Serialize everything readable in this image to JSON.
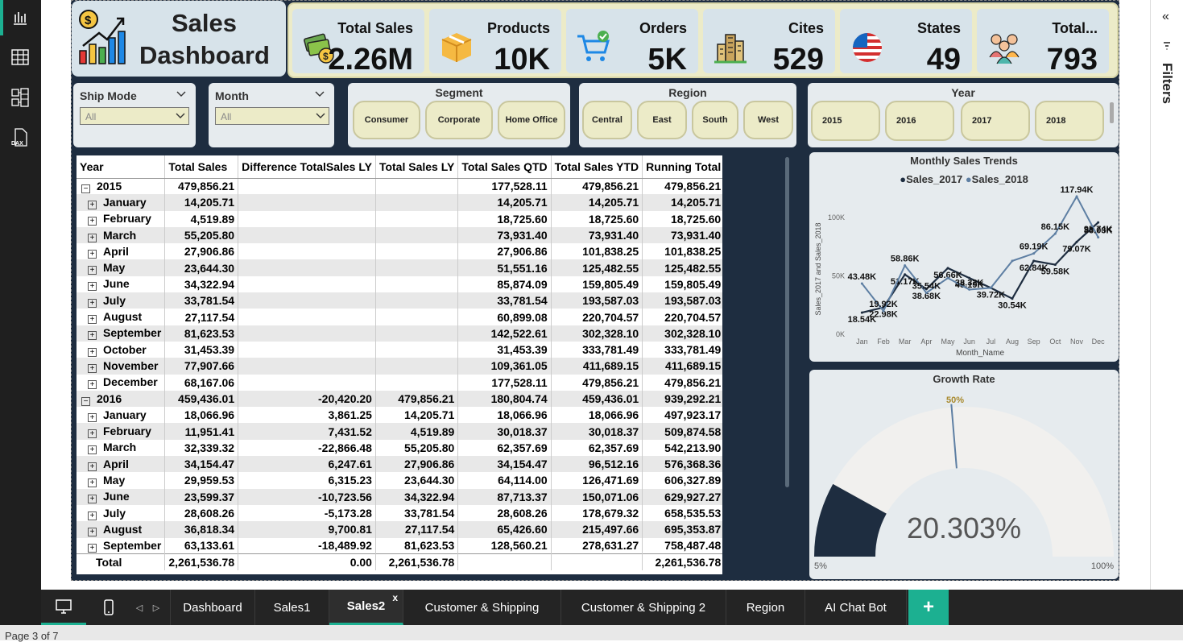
{
  "kpis": {
    "title_line1": "Sales",
    "title_line2": "Dashboard",
    "items": [
      {
        "label": "Total Sales",
        "value": "2.26M",
        "icon": "money-icon"
      },
      {
        "label": "Products",
        "value": "10K",
        "icon": "box-icon"
      },
      {
        "label": "Orders",
        "value": "5K",
        "icon": "cart-icon"
      },
      {
        "label": "Cites",
        "value": "529",
        "icon": "city-icon"
      },
      {
        "label": "States",
        "value": "49",
        "icon": "flag-icon"
      },
      {
        "label": "Total...",
        "value": "793",
        "icon": "people-icon"
      }
    ]
  },
  "filters": {
    "ship_mode": {
      "label": "Ship Mode",
      "value": "All"
    },
    "month": {
      "label": "Month",
      "value": "All"
    },
    "segment": {
      "label": "Segment",
      "options": [
        "Consumer",
        "Corporate",
        "Home Office"
      ]
    },
    "region": {
      "label": "Region",
      "options": [
        "Central",
        "East",
        "South",
        "West"
      ]
    },
    "year": {
      "label": "Year",
      "options": [
        "2015",
        "2016",
        "2017",
        "2018"
      ]
    }
  },
  "table": {
    "headers": [
      "Year",
      "Total Sales",
      "Difference TotalSales LY",
      "Total Sales LY",
      "Total Sales QTD",
      "Total Sales YTD",
      "Running Total"
    ],
    "rows": [
      {
        "label": "2015",
        "level": 0,
        "cells": [
          "479,856.21",
          "",
          "",
          "177,528.11",
          "479,856.21",
          "479,856.21"
        ]
      },
      {
        "label": "January",
        "level": 1,
        "cells": [
          "14,205.71",
          "",
          "",
          "14,205.71",
          "14,205.71",
          "14,205.71"
        ]
      },
      {
        "label": "February",
        "level": 1,
        "cells": [
          "4,519.89",
          "",
          "",
          "18,725.60",
          "18,725.60",
          "18,725.60"
        ]
      },
      {
        "label": "March",
        "level": 1,
        "cells": [
          "55,205.80",
          "",
          "",
          "73,931.40",
          "73,931.40",
          "73,931.40"
        ]
      },
      {
        "label": "April",
        "level": 1,
        "cells": [
          "27,906.86",
          "",
          "",
          "27,906.86",
          "101,838.25",
          "101,838.25"
        ]
      },
      {
        "label": "May",
        "level": 1,
        "cells": [
          "23,644.30",
          "",
          "",
          "51,551.16",
          "125,482.55",
          "125,482.55"
        ]
      },
      {
        "label": "June",
        "level": 1,
        "cells": [
          "34,322.94",
          "",
          "",
          "85,874.09",
          "159,805.49",
          "159,805.49"
        ]
      },
      {
        "label": "July",
        "level": 1,
        "cells": [
          "33,781.54",
          "",
          "",
          "33,781.54",
          "193,587.03",
          "193,587.03"
        ]
      },
      {
        "label": "August",
        "level": 1,
        "cells": [
          "27,117.54",
          "",
          "",
          "60,899.08",
          "220,704.57",
          "220,704.57"
        ]
      },
      {
        "label": "September",
        "level": 1,
        "cells": [
          "81,623.53",
          "",
          "",
          "142,522.61",
          "302,328.10",
          "302,328.10"
        ]
      },
      {
        "label": "October",
        "level": 1,
        "cells": [
          "31,453.39",
          "",
          "",
          "31,453.39",
          "333,781.49",
          "333,781.49"
        ]
      },
      {
        "label": "November",
        "level": 1,
        "cells": [
          "77,907.66",
          "",
          "",
          "109,361.05",
          "411,689.15",
          "411,689.15"
        ]
      },
      {
        "label": "December",
        "level": 1,
        "cells": [
          "68,167.06",
          "",
          "",
          "177,528.11",
          "479,856.21",
          "479,856.21"
        ]
      },
      {
        "label": "2016",
        "level": 0,
        "cells": [
          "459,436.01",
          "-20,420.20",
          "479,856.21",
          "180,804.74",
          "459,436.01",
          "939,292.21"
        ]
      },
      {
        "label": "January",
        "level": 1,
        "cells": [
          "18,066.96",
          "3,861.25",
          "14,205.71",
          "18,066.96",
          "18,066.96",
          "497,923.17"
        ]
      },
      {
        "label": "February",
        "level": 1,
        "cells": [
          "11,951.41",
          "7,431.52",
          "4,519.89",
          "30,018.37",
          "30,018.37",
          "509,874.58"
        ]
      },
      {
        "label": "March",
        "level": 1,
        "cells": [
          "32,339.32",
          "-22,866.48",
          "55,205.80",
          "62,357.69",
          "62,357.69",
          "542,213.90"
        ]
      },
      {
        "label": "April",
        "level": 1,
        "cells": [
          "34,154.47",
          "6,247.61",
          "27,906.86",
          "34,154.47",
          "96,512.16",
          "576,368.36"
        ]
      },
      {
        "label": "May",
        "level": 1,
        "cells": [
          "29,959.53",
          "6,315.23",
          "23,644.30",
          "64,114.00",
          "126,471.69",
          "606,327.89"
        ]
      },
      {
        "label": "June",
        "level": 1,
        "cells": [
          "23,599.37",
          "-10,723.56",
          "34,322.94",
          "87,713.37",
          "150,071.06",
          "629,927.27"
        ]
      },
      {
        "label": "July",
        "level": 1,
        "cells": [
          "28,608.26",
          "-5,173.28",
          "33,781.54",
          "28,608.26",
          "178,679.32",
          "658,535.53"
        ]
      },
      {
        "label": "August",
        "level": 1,
        "cells": [
          "36,818.34",
          "9,700.81",
          "27,117.54",
          "65,426.60",
          "215,497.66",
          "695,353.87"
        ]
      },
      {
        "label": "September",
        "level": 1,
        "cells": [
          "63,133.61",
          "-18,489.92",
          "81,623.53",
          "128,560.21",
          "278,631.27",
          "758,487.48"
        ]
      }
    ],
    "total": {
      "label": "Total",
      "cells": [
        "2,261,536.78",
        "0.00",
        "2,261,536.78",
        "",
        "",
        "2,261,536.78"
      ]
    }
  },
  "chart_data": [
    {
      "type": "line",
      "title": "Monthly Sales Trends",
      "xlabel": "Month_Name",
      "ylabel": "Sales_2017 and Sales_2018",
      "categories": [
        "Jan",
        "Feb",
        "Mar",
        "Apr",
        "May",
        "Jun",
        "Jul",
        "Aug",
        "Sep",
        "Oct",
        "Nov",
        "Dec"
      ],
      "yticks": [
        "0K",
        "50K",
        "100K"
      ],
      "ylim": [
        0,
        120000
      ],
      "series": [
        {
          "name": "Sales_2017",
          "color": "#1e2d40",
          "values": [
            18540,
            22980,
            51170,
            38680,
            56660,
            48190,
            39720,
            30540,
            62840,
            59580,
            79070,
            95740
          ],
          "labels": [
            "18.54K",
            "22.98K",
            "51.17K",
            "38.68K",
            "56.66K",
            "48.19K",
            "39.72K",
            "30.54K",
            "62.84K",
            "59.58K",
            "79.07K",
            "95.74K"
          ]
        },
        {
          "name": "Sales_2018",
          "color": "#5e7fa3",
          "values": [
            43480,
            19920,
            58860,
            35540,
            48190,
            38320,
            39720,
            62840,
            69190,
            86150,
            117940,
            83030
          ],
          "labels": [
            "43.48K",
            "19.92K",
            "58.86K",
            "35.54K",
            "",
            "38.32K",
            "",
            "",
            "69.19K",
            "86.15K",
            "117.94K",
            "83.03K"
          ]
        }
      ]
    },
    {
      "type": "gauge",
      "title": "Growth Rate",
      "value_label": "20.303%",
      "value": 20.303,
      "min_label": "5%",
      "max_label": "100%",
      "target_label": "50%",
      "min": 5,
      "max": 100,
      "target": 50
    }
  ],
  "sidebar": {
    "filters_label": "Filters",
    "collapse_icon": "double-chevron-left-icon"
  },
  "tabs": [
    {
      "label": "Dashboard"
    },
    {
      "label": "Sales1"
    },
    {
      "label": "Sales2",
      "active": true
    },
    {
      "label": "Customer & Shipping"
    },
    {
      "label": "Customer & Shipping 2"
    },
    {
      "label": "Region"
    },
    {
      "label": "AI Chat Bot"
    }
  ],
  "tab_close": "x",
  "add_tab": "+",
  "status": {
    "page": "Page 3 of 7"
  }
}
